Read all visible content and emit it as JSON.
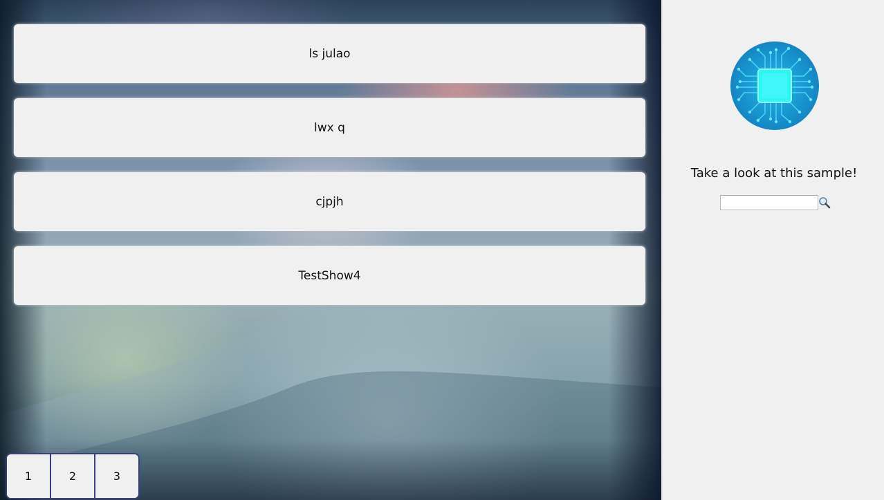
{
  "list": {
    "items": [
      {
        "label": "ls julao"
      },
      {
        "label": "lwx q"
      },
      {
        "label": "cjpjh"
      },
      {
        "label": "TestShow4"
      }
    ]
  },
  "pagination": {
    "pages": [
      "1",
      "2",
      "3"
    ],
    "border_color": "#3d3f7a"
  },
  "sidebar": {
    "logo_icon": "circuit-chip-icon",
    "tagline": "Take a look at this sample!",
    "search": {
      "value": "",
      "placeholder": ""
    },
    "search_icon": "magnifier-icon"
  },
  "colors": {
    "card_bg": "#f0f0f0",
    "panel_bg": "#f0f0f0",
    "logo_blue": "#1aa3d9",
    "chip_cyan": "#2ef5f5"
  }
}
